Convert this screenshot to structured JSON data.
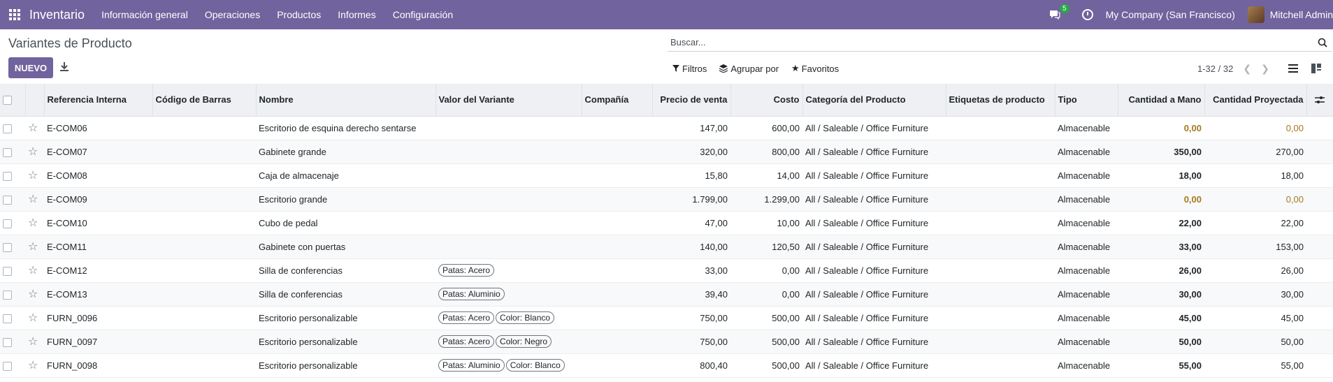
{
  "navbar": {
    "app_name": "Inventario",
    "menu": [
      "Información general",
      "Operaciones",
      "Productos",
      "Informes",
      "Configuración"
    ],
    "chat_count": "5",
    "company": "My Company (San Francisco)",
    "user": "Mitchell Admin"
  },
  "control": {
    "title": "Variantes de Producto",
    "new_label": "NUEVO",
    "search_placeholder": "Buscar...",
    "filters_label": "Filtros",
    "groupby_label": "Agrupar por",
    "favorites_label": "Favoritos",
    "pager": "1-32 / 32"
  },
  "table": {
    "headers": {
      "ref": "Referencia Interna",
      "barcode": "Código de Barras",
      "name": "Nombre",
      "variant": "Valor del Variante",
      "company": "Compañía",
      "price": "Precio de venta",
      "cost": "Costo",
      "category": "Categoría del Producto",
      "tags": "Etiquetas de producto",
      "type": "Tipo",
      "onhand": "Cantidad a Mano",
      "forecast": "Cantidad Proyectada"
    },
    "rows": [
      {
        "ref": "E-COM06",
        "name": "Escritorio de esquina derecho sentarse",
        "tags": [],
        "price": "147,00",
        "cost": "600,00",
        "category": "All / Saleable / Office Furniture",
        "type": "Almacenable",
        "onhand": "0,00",
        "forecast": "0,00",
        "warn": true
      },
      {
        "ref": "E-COM07",
        "name": "Gabinete grande",
        "tags": [],
        "price": "320,00",
        "cost": "800,00",
        "category": "All / Saleable / Office Furniture",
        "type": "Almacenable",
        "onhand": "350,00",
        "forecast": "270,00",
        "warn": false
      },
      {
        "ref": "E-COM08",
        "name": "Caja de almacenaje",
        "tags": [],
        "price": "15,80",
        "cost": "14,00",
        "category": "All / Saleable / Office Furniture",
        "type": "Almacenable",
        "onhand": "18,00",
        "forecast": "18,00",
        "warn": false
      },
      {
        "ref": "E-COM09",
        "name": "Escritorio grande",
        "tags": [],
        "price": "1.799,00",
        "cost": "1.299,00",
        "category": "All / Saleable / Office Furniture",
        "type": "Almacenable",
        "onhand": "0,00",
        "forecast": "0,00",
        "warn": true
      },
      {
        "ref": "E-COM10",
        "name": "Cubo de pedal",
        "tags": [],
        "price": "47,00",
        "cost": "10,00",
        "category": "All / Saleable / Office Furniture",
        "type": "Almacenable",
        "onhand": "22,00",
        "forecast": "22,00",
        "warn": false
      },
      {
        "ref": "E-COM11",
        "name": "Gabinete con puertas",
        "tags": [],
        "price": "140,00",
        "cost": "120,50",
        "category": "All / Saleable / Office Furniture",
        "type": "Almacenable",
        "onhand": "33,00",
        "forecast": "153,00",
        "warn": false
      },
      {
        "ref": "E-COM12",
        "name": "Silla de conferencias",
        "tags": [
          "Patas: Acero"
        ],
        "price": "33,00",
        "cost": "0,00",
        "category": "All / Saleable / Office Furniture",
        "type": "Almacenable",
        "onhand": "26,00",
        "forecast": "26,00",
        "warn": false
      },
      {
        "ref": "E-COM13",
        "name": "Silla de conferencias",
        "tags": [
          "Patas: Aluminio"
        ],
        "price": "39,40",
        "cost": "0,00",
        "category": "All / Saleable / Office Furniture",
        "type": "Almacenable",
        "onhand": "30,00",
        "forecast": "30,00",
        "warn": false
      },
      {
        "ref": "FURN_0096",
        "name": "Escritorio personalizable",
        "tags": [
          "Patas: Acero",
          "Color: Blanco"
        ],
        "price": "750,00",
        "cost": "500,00",
        "category": "All / Saleable / Office Furniture",
        "type": "Almacenable",
        "onhand": "45,00",
        "forecast": "45,00",
        "warn": false
      },
      {
        "ref": "FURN_0097",
        "name": "Escritorio personalizable",
        "tags": [
          "Patas: Acero",
          "Color: Negro"
        ],
        "price": "750,00",
        "cost": "500,00",
        "category": "All / Saleable / Office Furniture",
        "type": "Almacenable",
        "onhand": "50,00",
        "forecast": "50,00",
        "warn": false
      },
      {
        "ref": "FURN_0098",
        "name": "Escritorio personalizable",
        "tags": [
          "Patas: Aluminio",
          "Color: Blanco"
        ],
        "price": "800,40",
        "cost": "500,00",
        "category": "All / Saleable / Office Furniture",
        "type": "Almacenable",
        "onhand": "55,00",
        "forecast": "55,00",
        "warn": false
      }
    ]
  },
  "colors": {
    "brand": "#71639e",
    "warning_qty": "#a47a1e",
    "badge": "#28a745"
  }
}
